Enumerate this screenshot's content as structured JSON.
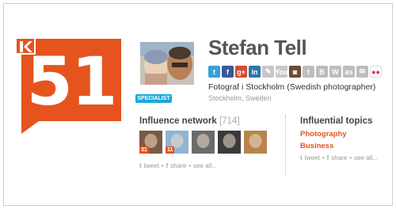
{
  "score": {
    "value": "51",
    "logo_letter": "K"
  },
  "profile": {
    "name": "Stefan Tell",
    "badge": "SPECIALIST",
    "bio": "Fotograf i Stockholm (Swedish photographer)",
    "location": "Stockholm, Sweden"
  },
  "social_icons": [
    {
      "name": "twitter-icon",
      "glyph": "t",
      "color": "#3b9fd8"
    },
    {
      "name": "facebook-icon",
      "glyph": "f",
      "color": "#3b5998"
    },
    {
      "name": "google-plus-icon",
      "glyph": "g+",
      "color": "#d64b32"
    },
    {
      "name": "linkedin-icon",
      "glyph": "in",
      "color": "#2a76a8"
    },
    {
      "name": "blog-icon",
      "glyph": "✎",
      "color": "#c8c8c8"
    },
    {
      "name": "youtube-icon",
      "glyph": "You",
      "color": "#c8c8c8"
    },
    {
      "name": "instagram-icon",
      "glyph": "◙",
      "color": "#6b4a36"
    },
    {
      "name": "tumblr-icon",
      "glyph": "t",
      "color": "#bdbdbd"
    },
    {
      "name": "blogger-icon",
      "glyph": "B",
      "color": "#bdbdbd"
    },
    {
      "name": "wordpress-icon",
      "glyph": "W",
      "color": "#bdbdbd"
    },
    {
      "name": "last-fm-icon",
      "glyph": "as",
      "color": "#bdbdbd"
    },
    {
      "name": "foursquare-icon",
      "glyph": "✉",
      "color": "#bdbdbd"
    },
    {
      "name": "flickr-icon",
      "glyph": "●●",
      "color": "#ffffff"
    }
  ],
  "influence_network": {
    "title": "Influence network",
    "count": "[714]",
    "thumbs": [
      {
        "badge": "31",
        "bg": "#7a5a44"
      },
      {
        "badge": "11",
        "bg": "#8fb4d4"
      },
      {
        "badge": "",
        "bg": "#6b6b6b"
      },
      {
        "badge": "",
        "bg": "#3a3a3a"
      },
      {
        "badge": "",
        "bg": "#b8844c"
      }
    ]
  },
  "topics": {
    "title": "Influential topics",
    "items": [
      "Photography",
      "Business"
    ]
  },
  "share": {
    "tweet": "tweet",
    "sep": "•",
    "share": "share",
    "see_all": "see all..."
  }
}
